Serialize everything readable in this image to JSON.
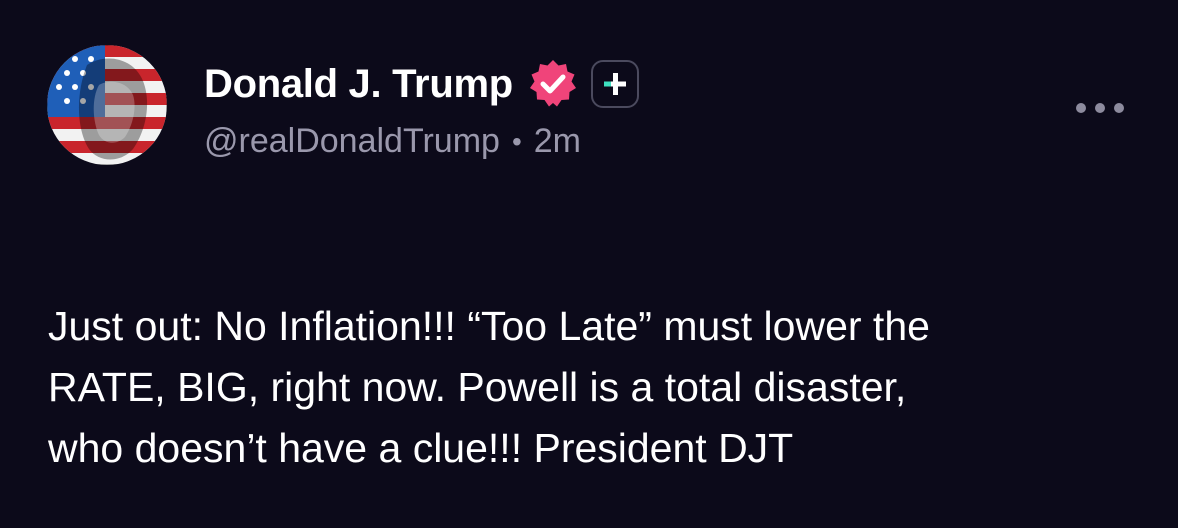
{
  "post": {
    "author": {
      "display_name": "Donald J. Trump",
      "handle": "@realDonaldTrump",
      "separator": "•",
      "time_ago": "2m",
      "verified_icon": "verified-badge-icon",
      "avatar_icon": "flag-portrait-avatar"
    },
    "follow_icon": "plus-icon",
    "more_icon": "more-horizontal-icon",
    "body_lines": [
      "Just out: No Inflation!!! “Too Late” must lower the",
      "RATE, BIG, right now. Powell is a total disaster,",
      "who doesn’t have a clue!!! President DJT"
    ]
  },
  "colors": {
    "background": "#0c0a1a",
    "verified_badge": "#f0447a",
    "plus_accent": "#3ee0c0",
    "secondary_text": "#9a98ac"
  }
}
